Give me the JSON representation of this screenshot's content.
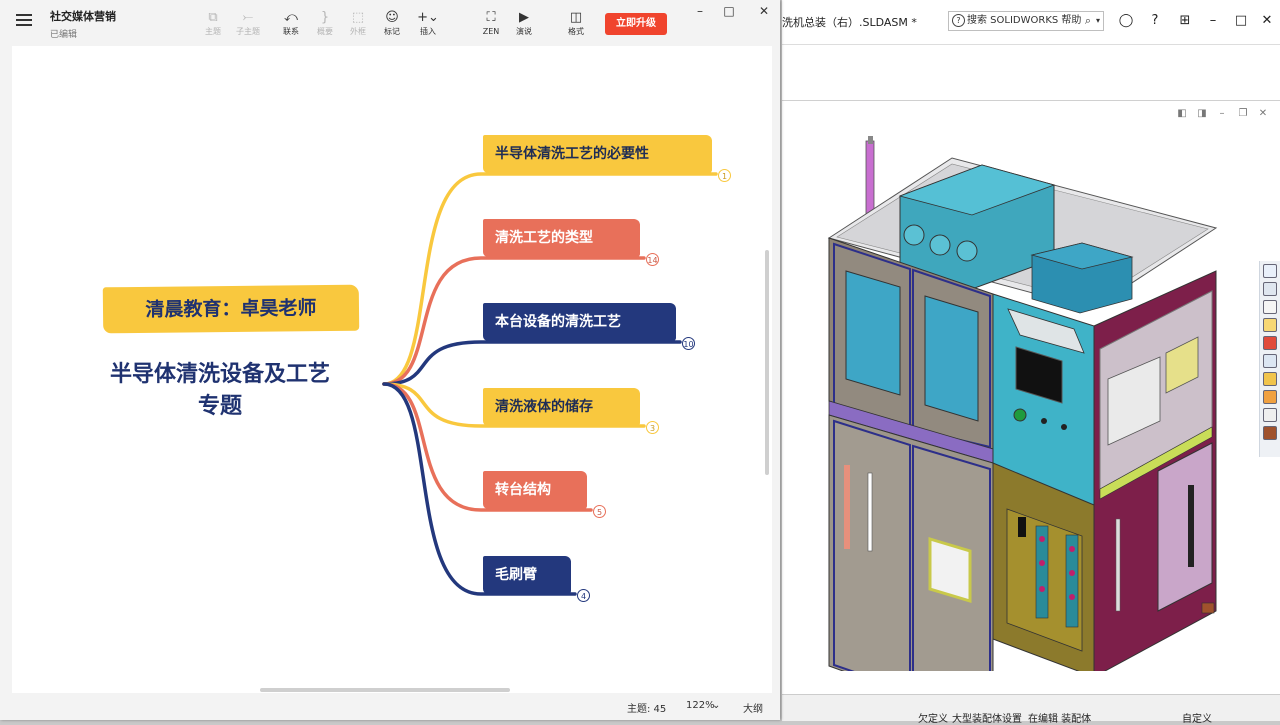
{
  "mindmap_app": {
    "doc_title": "社交媒体营销",
    "doc_status": "已编辑",
    "toolbar": [
      {
        "label": "主题",
        "icon": "topic-icon",
        "glyph": "⧉",
        "enabled": false
      },
      {
        "label": "子主题",
        "icon": "subtopic-icon",
        "glyph": "⤚",
        "enabled": false
      },
      {
        "label": "联系",
        "icon": "relationship-icon",
        "glyph": "⤺",
        "enabled": true
      },
      {
        "label": "概要",
        "icon": "summary-icon",
        "glyph": "}",
        "enabled": false
      },
      {
        "label": "外框",
        "icon": "boundary-icon",
        "glyph": "⬚",
        "enabled": false
      },
      {
        "label": "标记",
        "icon": "marker-icon",
        "glyph": "☺",
        "enabled": true
      },
      {
        "label": "插入",
        "icon": "insert-icon",
        "glyph": "+⌄",
        "enabled": true
      },
      {
        "label": "ZEN",
        "icon": "zen-mode-icon",
        "glyph": "⛶",
        "enabled": true
      },
      {
        "label": "演说",
        "icon": "pitch-icon",
        "glyph": "▶",
        "enabled": true
      },
      {
        "label": "格式",
        "icon": "format-panel-icon",
        "glyph": "◫",
        "enabled": true
      }
    ],
    "upgrade_button": "立即升级",
    "window_controls": {
      "minimize": "–",
      "maximize": "□",
      "close": "✕"
    },
    "status": {
      "topic_label": "主题: 45",
      "zoom": "122%",
      "zoom_arrow": "⌄",
      "outline": "大纲"
    },
    "map": {
      "teacher_label": "清晨教育：卓昊老师",
      "root_line1": "半导体清洗设备及工艺",
      "root_line2": "专题",
      "branches": [
        {
          "label": "半导体清洗工艺的必要性",
          "count": "1",
          "color": "#f9c83e",
          "style": "yellow"
        },
        {
          "label": "清洗工艺的类型",
          "count": "14",
          "color": "#e8705a",
          "style": "coral"
        },
        {
          "label": "本台设备的清洗工艺",
          "count": "10",
          "color": "#23387d",
          "style": "navy"
        },
        {
          "label": "清洗液体的储存",
          "count": "3",
          "color": "#f9c83e",
          "style": "yellow"
        },
        {
          "label": "转台结构",
          "count": "5",
          "color": "#e8705a",
          "style": "coral"
        },
        {
          "label": "毛刷臂",
          "count": "4",
          "color": "#23387d",
          "style": "navy"
        }
      ]
    }
  },
  "solidworks": {
    "doc_title": "洗机总装（右）.SLDASM *",
    "search_placeholder": "搜索 SOLIDWORKS 帮助",
    "search_glyph": "?",
    "search_mag": "⌕",
    "search_dropdown": "▾",
    "title_icons": [
      {
        "name": "user-account-icon",
        "glyph": "◯"
      },
      {
        "name": "help-icon",
        "glyph": "?"
      },
      {
        "name": "restore-panel-icon",
        "glyph": "⊞"
      },
      {
        "name": "minimize-icon",
        "glyph": "–"
      },
      {
        "name": "maximize-icon",
        "glyph": "□"
      },
      {
        "name": "close-icon",
        "glyph": "✕"
      }
    ],
    "viewport_buttons": [
      "◧",
      "◨",
      "–",
      "❐",
      "✕"
    ],
    "status": {
      "undefined": "欠定义",
      "large_assembly": "大型装配体设置",
      "editing": "在编辑 装配体",
      "custom": "自定义"
    },
    "model_panel_colors": {
      "frame": "#9aa0a6",
      "teal": "#3fb3c8",
      "magenta": "#7d1f4a",
      "olive": "#8c7a2c",
      "lavender": "#c9a6c9"
    }
  }
}
